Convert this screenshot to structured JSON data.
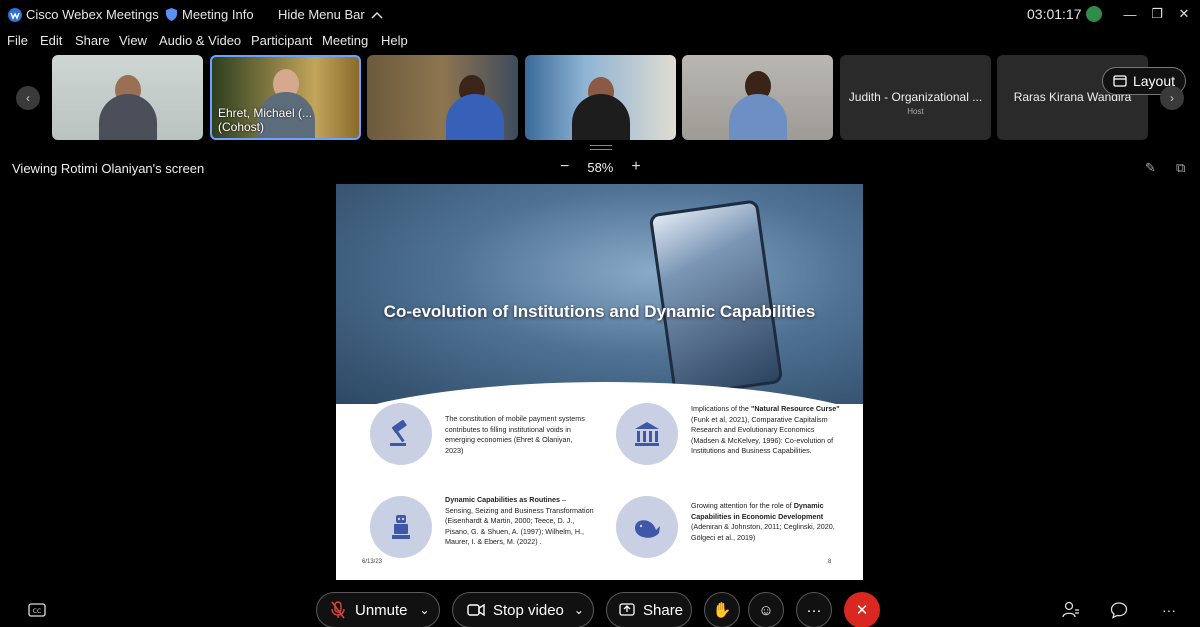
{
  "titlebar": {
    "app_name": "Cisco Webex Meetings",
    "meeting_info": "Meeting Info",
    "hide_menu": "Hide Menu Bar",
    "clock": "03:01:17"
  },
  "menu": [
    "File",
    "Edit",
    "Share",
    "View",
    "Audio & Video",
    "Participant",
    "Meeting",
    "Help"
  ],
  "participants": [
    {
      "name": ""
    },
    {
      "name": "Ehret, Michael (... (Cohost)"
    },
    {
      "name": ""
    },
    {
      "name": ""
    },
    {
      "name": ""
    },
    {
      "name": "Judith - Organizational ...",
      "role": "Host"
    },
    {
      "name": "Raras Kirana Wandira"
    }
  ],
  "layout_label": "Layout",
  "viewing_label": "Viewing Rotimi Olaniyan's screen",
  "zoom_level": "58%",
  "slide": {
    "title": "Co-evolution of Institutions and Dynamic Capabilities",
    "p1": "The constitution of mobile payment systems contributes to filling institutional voids in emerging economies (Ehret & Olaniyan, 2023)",
    "p2_pre": "Implications of the ",
    "p2_bold": "\"Natural Resource Curse\"",
    "p2_post": " (Funk et al, 2021), Comparative Capitalism Research and Evolutionary Economics (Madsen & McKelvey, 1996): Co-evolution of Institutions and Business Capabilities.",
    "p3_bold": "Dynamic Capabilities as Routines",
    "p3_post": " – Sensing, Seizing and Business Transformation (Eisenhardt & Martin, 2000; Teece, D. J., Pisano, G. & Shuen, A. (1997); Wilhelm, H., Maurer, I. & Ebers, M. (2022) .",
    "p4_pre": "Growing attention for the role of ",
    "p4_bold": "Dynamic Capabilities in Economic Development",
    "p4_post": " (Adeniran & Johnston, 2011; Ceglinski, 2020, Gölgeci et al., 2019)",
    "date": "6/13/23",
    "page": "8"
  },
  "toolbar": {
    "unmute": "Unmute",
    "stop_video": "Stop video",
    "share": "Share"
  },
  "colors": {
    "accent": "#6aa2ff",
    "end_call": "#d8281f",
    "slide_circle": "#c9d0e3",
    "slide_icon": "#3f57a8"
  },
  "icons": [
    "webex-logo-icon",
    "shield-icon",
    "chevron-up-icon",
    "signal-icon",
    "minimize-icon",
    "restore-icon",
    "close-icon",
    "chevron-left-icon",
    "chevron-right-icon",
    "layout-icon",
    "annotate-icon",
    "popout-icon",
    "gavel-icon",
    "bank-icon",
    "robot-icon",
    "whale-icon",
    "cc-icon",
    "mic-muted-icon",
    "camera-icon",
    "share-screen-icon",
    "hand-icon",
    "emoji-icon",
    "more-icon",
    "end-call-icon",
    "participants-icon",
    "chat-icon"
  ]
}
